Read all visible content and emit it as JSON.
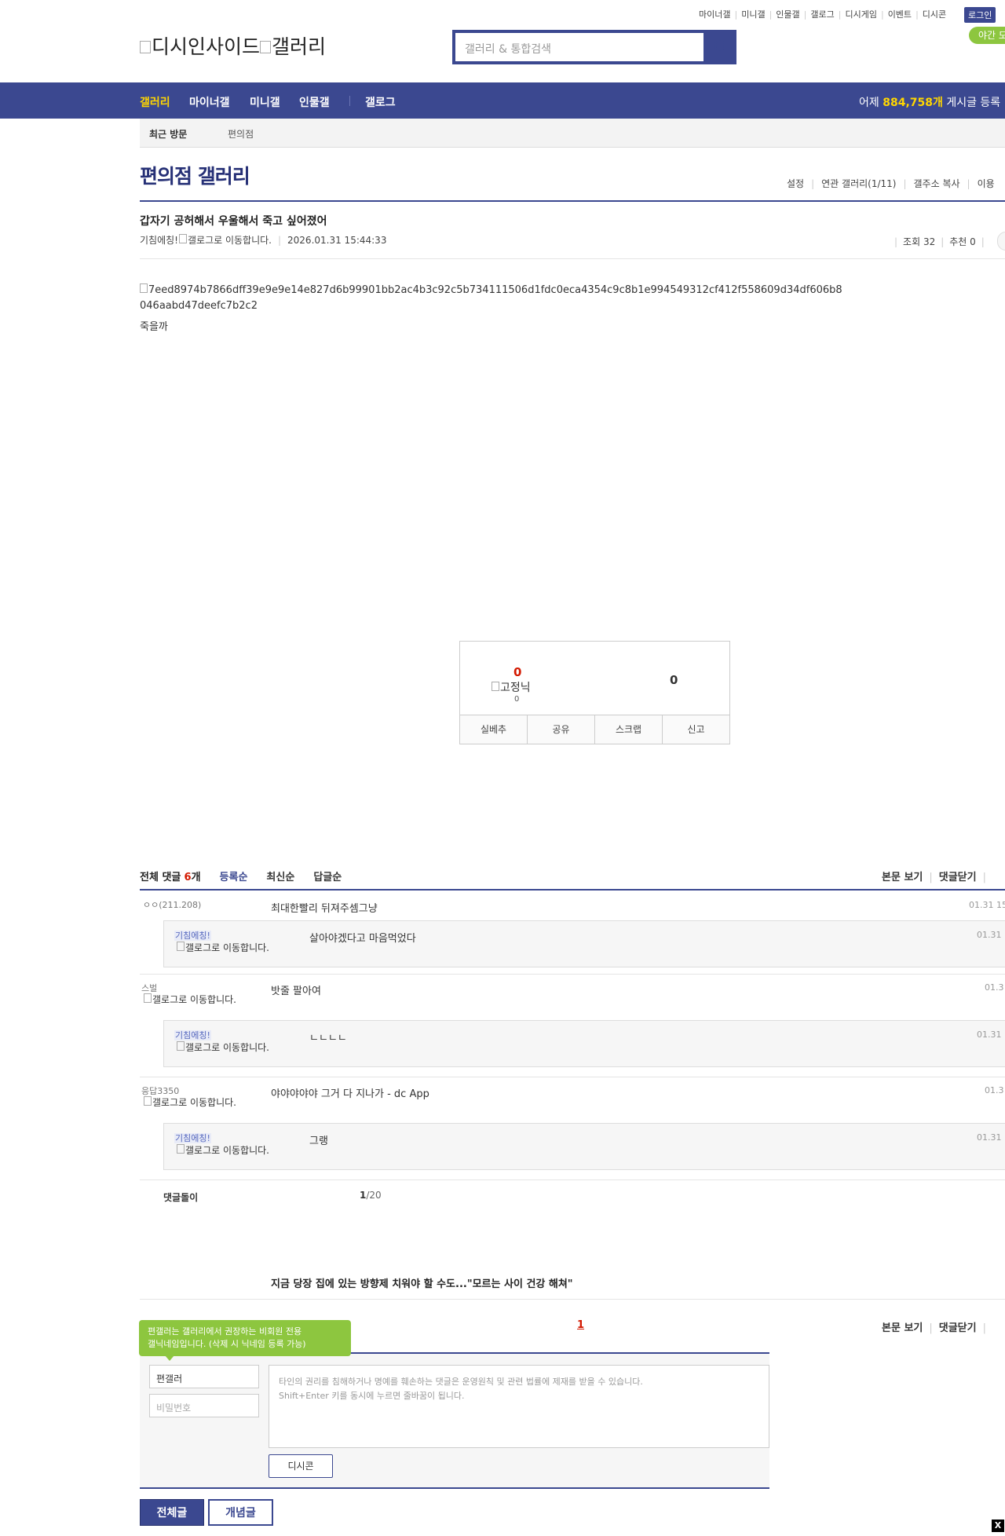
{
  "top_links": [
    "마이너갤",
    "미니갤",
    "인물갤",
    "갤로그",
    "디시게임",
    "이벤트",
    "디시콘"
  ],
  "login": "로그인",
  "night_mode": "야간 모",
  "logo_alt": "디시인사이드",
  "logo_alt2": "갤러리",
  "search": {
    "placeholder": "갤러리 & 통합검색"
  },
  "nav": {
    "items": [
      "갤러리",
      "마이너갤",
      "미니갤",
      "인물갤",
      "갤로그"
    ],
    "stats_prefix": "어제",
    "stats_count": "884,758개",
    "stats_suffix": "게시글 등록"
  },
  "visit": {
    "label": "최근 방문",
    "item": "편의점"
  },
  "gallery": {
    "title": "편의점 갤러리",
    "tools": [
      "설정",
      "연관 갤러리(1/11)",
      "갤주소 복사",
      "이용"
    ]
  },
  "post": {
    "title": "갑자기 공허해서 우울해서 죽고 싶어졌어",
    "author": "기침에칭!",
    "author_img_alt": "갤로그로 이동합니다.",
    "datetime": "2026.01.31 15:44:33",
    "views_label": "조회 32",
    "recommend_label": "추천 0",
    "image_alt": "7eed8974b7866dff39e9e9e14e827d6b99901bb2ac4b3c92c5b734111506d1fdc0eca4354c9c8b1e994549312cf412f558609d34df606b8046aabd47deefc7b2c2",
    "body": "죽을까"
  },
  "recommend": {
    "up_count": "0",
    "fixed_alt": "고정닉",
    "fixed_count": "0",
    "down_count": "0",
    "buttons": [
      "실베추",
      "공유",
      "스크랩",
      "신고"
    ]
  },
  "comments": {
    "total_label": "전체 댓글",
    "total_count": "6",
    "total_unit": "개",
    "sort": [
      "등록순",
      "최신순",
      "답글순"
    ],
    "right": [
      "본문 보기",
      "댓글닫기"
    ],
    "list": [
      {
        "nick": "ㅇㅇ",
        "ip": "(211.208)",
        "text": "최대한빨리 뒤져주셈그냥",
        "date": "01.31 15",
        "reply": {
          "nick": "기침에칭!",
          "img_alt": "갤로그로 이동합니다.",
          "text": "살아야겠다고 마음먹었다",
          "date": "01.31 1"
        }
      },
      {
        "nick": "스벌",
        "img_alt": "갤로그로 이동합니다.",
        "text": "밧줄 팔아여",
        "date": "01.3",
        "reply": {
          "nick": "기침에칭!",
          "img_alt": "갤로그로 이동합니다.",
          "text": "ㄴㄴㄴㄴ",
          "date": "01.31 1"
        }
      },
      {
        "nick": "응답3350",
        "img_alt": "갤로그로 이동합니다.",
        "text": "야야야야야 그거 다 지나가 - dc App",
        "date": "01.3",
        "reply": {
          "nick": "기침에칭!",
          "img_alt": "갤로그로 이동합니다.",
          "text": "그랭",
          "date": "01.31 1"
        }
      }
    ],
    "dol_title": "댓글돌이",
    "page_current": "1",
    "page_total": "/20"
  },
  "news": "지금 당장 집에 있는 방향제 치워야 할 수도...\"모르는 사이 건강 해쳐\"",
  "bottom": {
    "page": "1",
    "right": [
      "본문 보기",
      "댓글닫기"
    ]
  },
  "write": {
    "tooltip_line1": "편갤러는 갤러리에서 권장하는 비회원 전용",
    "tooltip_line2": "갤닉네임입니다. (삭제 시 닉네임 등록 가능)",
    "nick_value": "편갤러",
    "password_placeholder": "비밀번호",
    "textarea_line1": "타인의 권리를 침해하거나 명예를 훼손하는 댓글은 운영원칙 및 관련 법률에 제재를 받을 수 있습니다.",
    "textarea_line2": "Shift+Enter 키를 동시에 누르면 줄바꿈이 됩니다.",
    "dccon": "디시콘"
  },
  "buttons": {
    "all": "전체글",
    "concept": "개념글",
    "close": "X"
  },
  "colors": {
    "brand": "#3b4890",
    "accent": "#ffd600",
    "green": "#8dc63f",
    "red": "#d31900"
  }
}
